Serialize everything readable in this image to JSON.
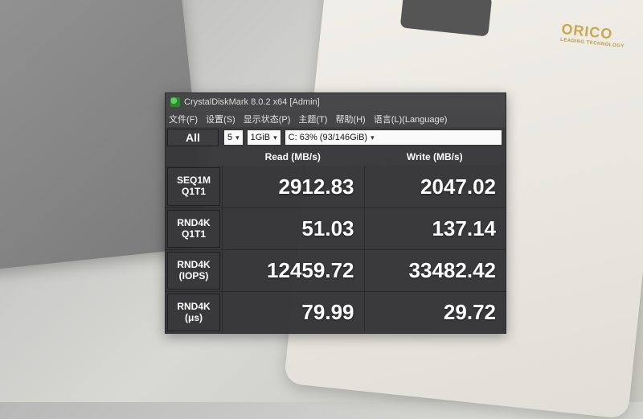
{
  "background": {
    "brand": "ORICO",
    "brand_sub": "LEADING TECHNOLOGY"
  },
  "window": {
    "title": "CrystalDiskMark 8.0.2 x64 [Admin]"
  },
  "menu": {
    "file": "文件(F)",
    "settings": "设置(S)",
    "profile": "显示状态(P)",
    "theme": "主题(T)",
    "help": "帮助(H)",
    "language": "语言(L)(Language)"
  },
  "controls": {
    "all_label": "All",
    "runs": "5",
    "size": "1GiB",
    "drive": "C: 63% (93/146GiB)"
  },
  "headers": {
    "read": "Read (MB/s)",
    "write": "Write (MB/s)"
  },
  "rows": [
    {
      "label1": "SEQ1M",
      "label2": "Q1T1",
      "read": "2912.83",
      "write": "2047.02"
    },
    {
      "label1": "RND4K",
      "label2": "Q1T1",
      "read": "51.03",
      "write": "137.14"
    },
    {
      "label1": "RND4K",
      "label2": "(IOPS)",
      "read": "12459.72",
      "write": "33482.42"
    },
    {
      "label1": "RND4K",
      "label2": "(μs)",
      "read": "79.99",
      "write": "29.72"
    }
  ]
}
